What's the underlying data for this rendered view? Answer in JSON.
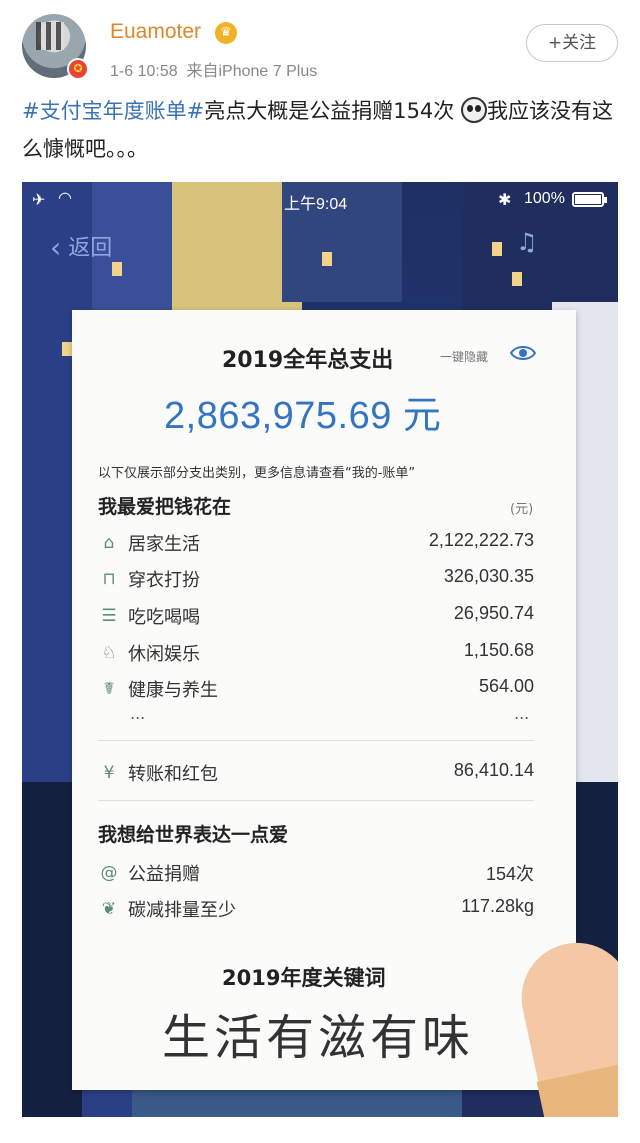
{
  "post": {
    "username": "Euamoter",
    "crown_icon": "crown-icon",
    "time": "1-6 10:58",
    "source": "来自iPhone 7 Plus",
    "follow_label": "+关注",
    "text_tag1": "#支付宝年度账单#",
    "text_part1": "亮点大概是公益捐赠154次",
    "text_part2": "我应该没有这么慷慨吧。。。",
    "emoji": "panda-icon"
  },
  "screenshot": {
    "status": {
      "time": "上午9:04",
      "battery_pct": "100%"
    },
    "back_label": "返回",
    "total": {
      "title": "2019全年总支出",
      "hide_label": "一键隐藏",
      "amount": "2,863,975.69 元"
    },
    "note": "以下仅展示部分支出类别，更多信息请查看“我的-账单”",
    "spend": {
      "title": "我最爱把钱花在",
      "unit": "(元)",
      "items": [
        {
          "icon": "home-icon",
          "label": "居家生活",
          "value": "2,122,222.73"
        },
        {
          "icon": "clothes-icon",
          "label": "穿衣打扮",
          "value": "326,030.35"
        },
        {
          "icon": "food-icon",
          "label": "吃吃喝喝",
          "value": "26,950.74"
        },
        {
          "icon": "leisure-icon",
          "label": "休闲娱乐",
          "value": "1,150.68"
        },
        {
          "icon": "health-icon",
          "label": "健康与养生",
          "value": "564.00"
        }
      ],
      "ellipsis": "...",
      "transfer": {
        "icon": "redpacket-icon",
        "label": "转账和红包",
        "value": "86,410.14"
      }
    },
    "love": {
      "title": "我想给世界表达一点爱",
      "items": [
        {
          "icon": "charity-icon",
          "label": "公益捐赠",
          "value": "154次"
        },
        {
          "icon": "leaf-icon",
          "label": "碳减排量至少",
          "value": "117.28kg"
        }
      ]
    },
    "keyword": {
      "title": "2019年度关键词",
      "value": "生活有滋有味"
    }
  }
}
